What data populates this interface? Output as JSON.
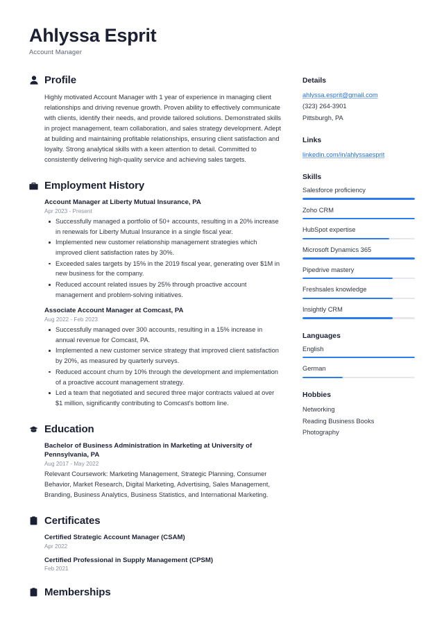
{
  "accent_color": "#2a7cf0",
  "link_color": "#2a6fd4",
  "text_color": "#2f3542",
  "heading_color": "#1c2033",
  "header": {
    "name": "Ahlyssa Esprit",
    "title": "Account Manager"
  },
  "sections": {
    "profile": {
      "icon": "person-icon",
      "title": "Profile",
      "text": "Highly motivated Account Manager with 1 year of experience in managing client relationships and driving revenue growth. Proven ability to effectively communicate with clients, identify their needs, and provide tailored solutions. Demonstrated skills in project management, team collaboration, and sales strategy development. Adept at building and maintaining profitable relationships, ensuring client satisfaction and loyalty. Strong analytical skills with a keen attention to detail. Committed to consistently delivering high-quality service and achieving sales targets."
    },
    "employment": {
      "icon": "briefcase-icon",
      "title": "Employment History",
      "entries": [
        {
          "title": "Account Manager at Liberty Mutual Insurance, PA",
          "date": "Apr 2023 - Present",
          "bullets": [
            "Successfully managed a portfolio of 50+ accounts, resulting in a 20% increase in renewals for Liberty Mutual Insurance in a single fiscal year.",
            "Implemented new customer relationship management strategies which improved client satisfaction rates by 30%.",
            "Exceeded sales targets by 15% in the 2019 fiscal year, generating over $1M in new business for the company.",
            "Reduced account related issues by 25% through proactive account management and problem-solving initiatives."
          ]
        },
        {
          "title": "Associate Account Manager at Comcast, PA",
          "date": "Aug 2022 - Feb 2023",
          "bullets": [
            "Successfully managed over 300 accounts, resulting in a 15% increase in annual revenue for Comcast, PA.",
            "Implemented a new customer service strategy that improved client satisfaction by 20%, as measured by quarterly surveys.",
            "Reduced account churn by 10% through the development and implementation of a proactive account management strategy.",
            "Led a team that negotiated and secured three major contracts valued at over $1 million, significantly contributing to Comcast's bottom line."
          ]
        }
      ]
    },
    "education": {
      "icon": "graduation-cap-icon",
      "title": "Education",
      "entries": [
        {
          "title": "Bachelor of Business Administration in Marketing at University of Pennsylvania, PA",
          "date": "Aug 2017 - May 2022",
          "description": "Relevant Coursework: Marketing Management, Strategic Planning, Consumer Behavior, Market Research, Digital Marketing, Advertising, Sales Management, Branding, Business Analytics, Business Statistics, and International Marketing."
        }
      ]
    },
    "certificates": {
      "icon": "clipboard-icon",
      "title": "Certificates",
      "entries": [
        {
          "title": "Certified Strategic Account Manager (CSAM)",
          "date": "Apr 2022"
        },
        {
          "title": "Certified Professional in Supply Management (CPSM)",
          "date": "Feb 2021"
        }
      ]
    },
    "memberships": {
      "icon": "clipboard-icon",
      "title": "Memberships"
    }
  },
  "sidebar": {
    "details": {
      "title": "Details",
      "email": "ahlyssa.esprit@gmail.com",
      "phone": "(323) 264-3901",
      "location": "Pittsburgh, PA"
    },
    "links": {
      "title": "Links",
      "items": [
        {
          "label": "linkedin.com/in/ahlyssaesprit"
        }
      ]
    },
    "skills": {
      "title": "Skills",
      "items": [
        {
          "label": "Salesforce proficiency",
          "level": 100
        },
        {
          "label": "Zoho CRM",
          "level": 100
        },
        {
          "label": "HubSpot expertise",
          "level": 77
        },
        {
          "label": "Microsoft Dynamics 365",
          "level": 100
        },
        {
          "label": "Pipedrive mastery",
          "level": 80
        },
        {
          "label": "Freshsales knowledge",
          "level": 80
        },
        {
          "label": "Insightly CRM",
          "level": 80
        }
      ]
    },
    "languages": {
      "title": "Languages",
      "items": [
        {
          "label": "English",
          "level": 100
        },
        {
          "label": "German",
          "level": 36
        }
      ]
    },
    "hobbies": {
      "title": "Hobbies",
      "items": [
        {
          "label": "Networking"
        },
        {
          "label": "Reading Business Books"
        },
        {
          "label": "Photography"
        }
      ]
    }
  }
}
